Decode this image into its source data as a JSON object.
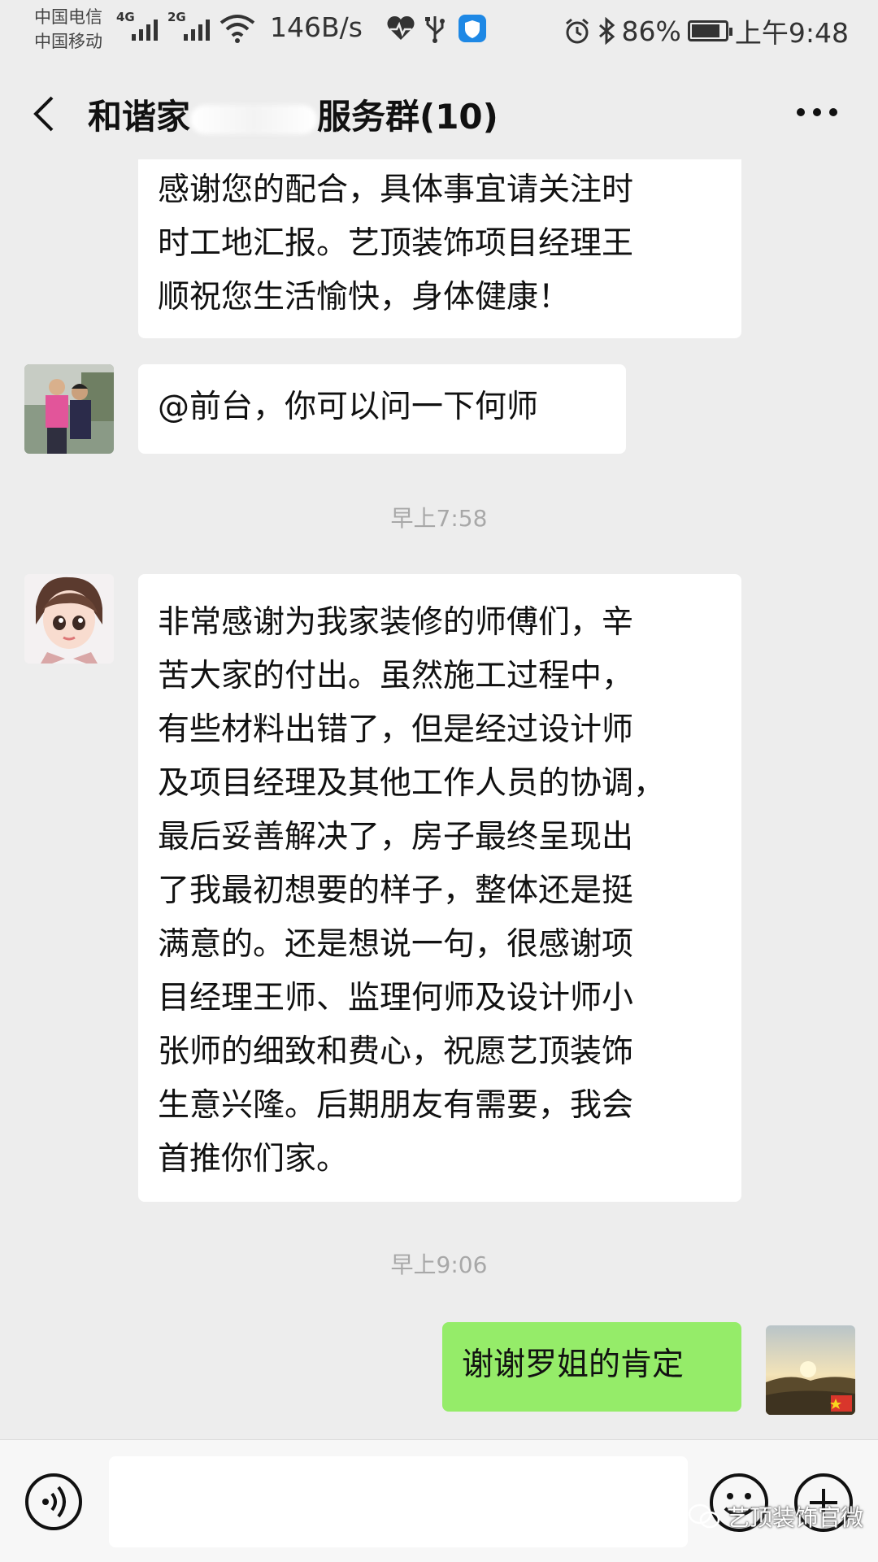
{
  "status_bar": {
    "carrier_1": "中国电信",
    "carrier_2": "中国移动",
    "network_1": "4G",
    "network_2": "2G",
    "speed": "146B/s",
    "battery_percent": "86%",
    "battery_level": 0.86,
    "time": "上午9:48"
  },
  "header": {
    "title_prefix": "和谐家",
    "title_suffix": "服务群(10)"
  },
  "messages": [
    {
      "side": "left",
      "lines": [
        "感谢您的配合，具体事宜请关注时",
        "时工地汇报。艺顶装饰项目经理王",
        "顺祝您生活愉快，身体健康！"
      ]
    },
    {
      "side": "left",
      "lines": [
        "@前台，你可以问一下何师"
      ]
    },
    {
      "side": "left",
      "lines": [
        "非常感谢为我家装修的师傅们，辛",
        "苦大家的付出。虽然施工过程中，",
        "有些材料出错了，但是经过设计师",
        "及项目经理及其他工作人员的协调，",
        "最后妥善解决了，房子最终呈现出",
        "了我最初想要的样子，整体还是挺",
        "满意的。还是想说一句，很感谢项",
        "目经理王师、监理何师及设计师小",
        "张师的细致和费心，祝愿艺顶装饰",
        "生意兴隆。后期朋友有需要，我会",
        "首推你们家。"
      ]
    },
    {
      "side": "right",
      "lines": [
        "谢谢罗姐的肯定"
      ]
    }
  ],
  "timestamps": [
    "早上7:58",
    "早上9:06"
  ],
  "watermark": "艺顶装饰官微"
}
